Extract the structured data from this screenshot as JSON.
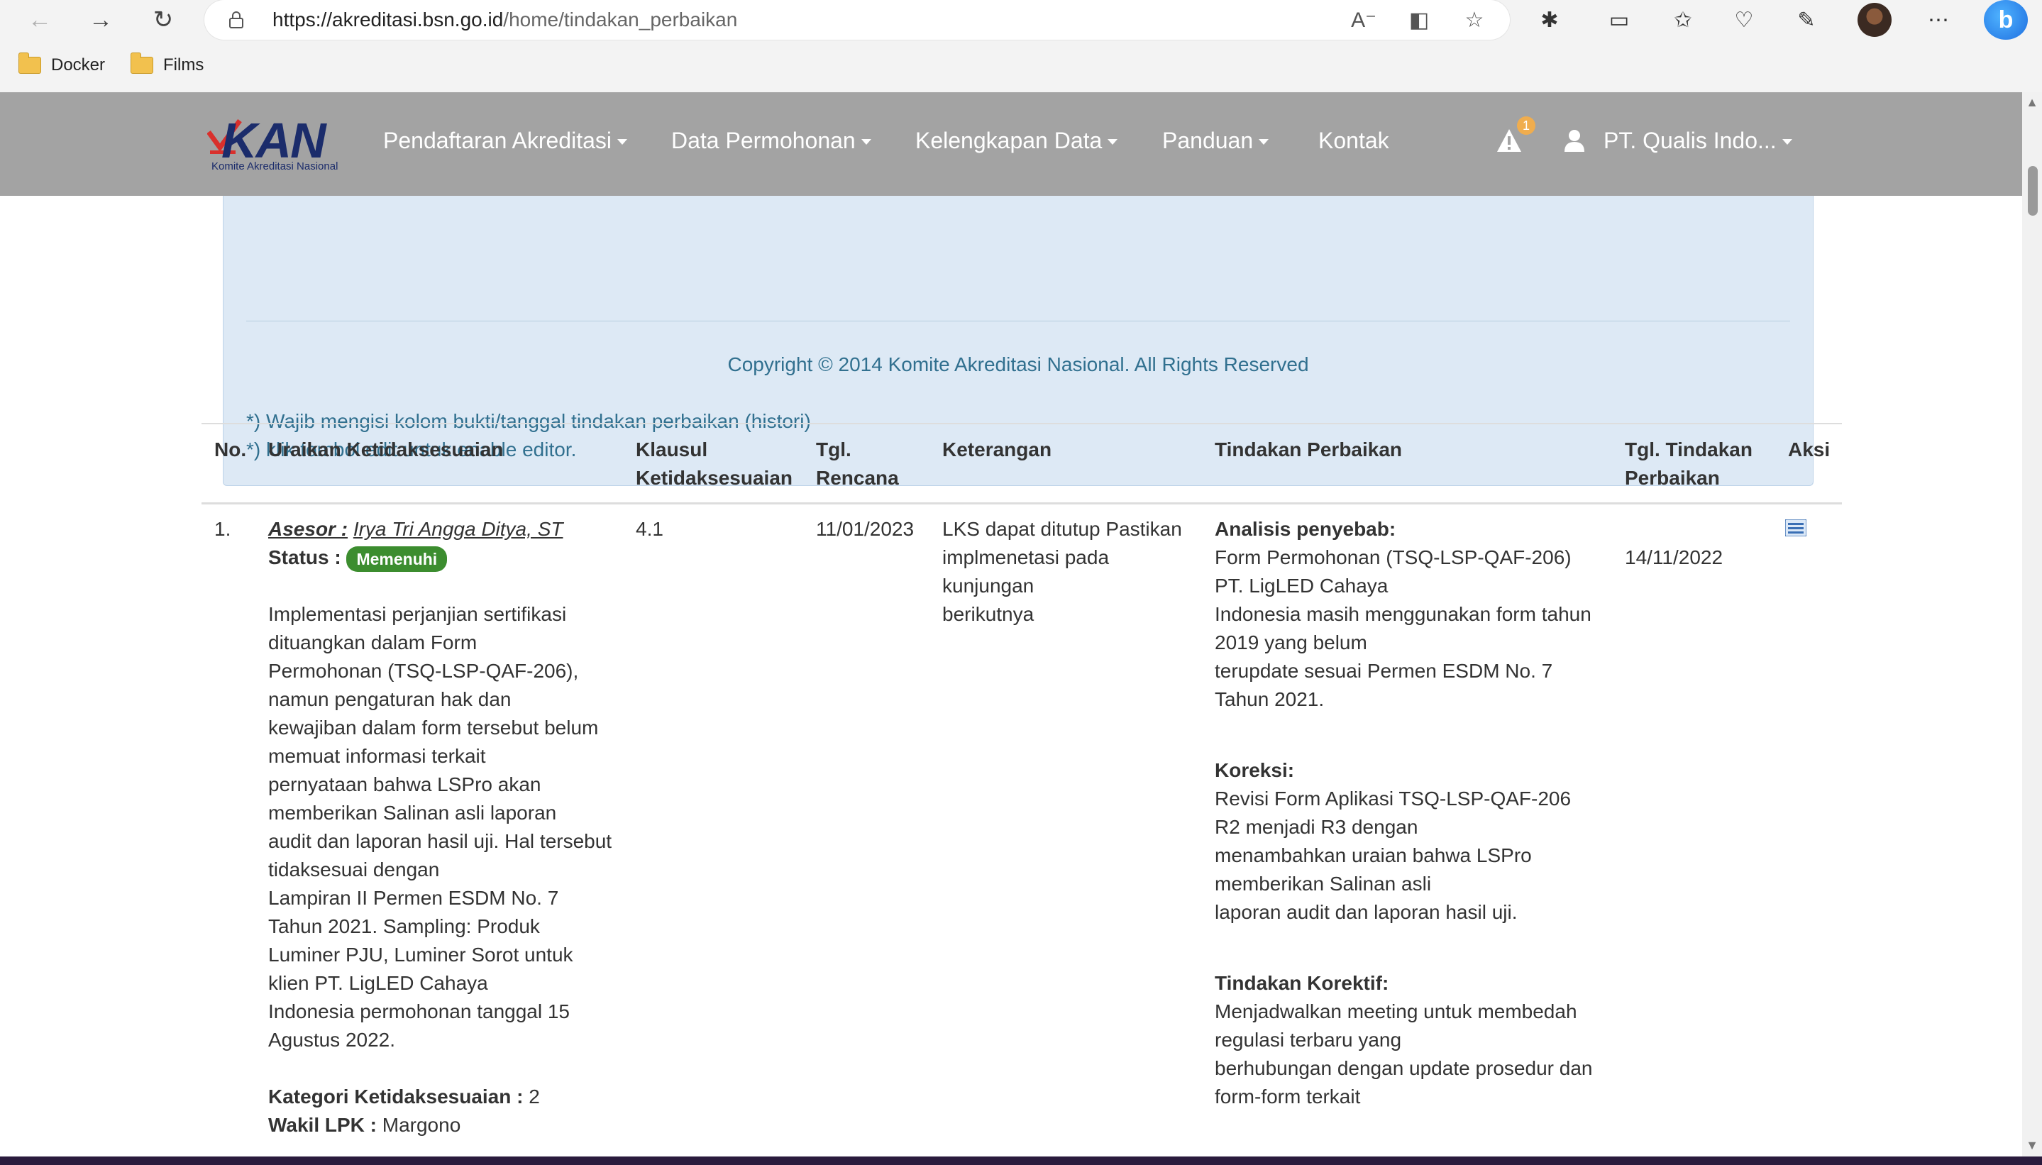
{
  "browser": {
    "url_host": "https://akreditasi.bsn.go.id",
    "url_path": "/home/tindakan_perbaikan",
    "bookmarks": [
      {
        "label": "Docker",
        "icon": "folder-icon"
      },
      {
        "label": "Films",
        "icon": "folder-icon"
      }
    ]
  },
  "site": {
    "logo_text": "KAN",
    "logo_tagline": "Komite Akreditasi Nasional",
    "menu": [
      {
        "label": "Pendaftaran Akreditasi"
      },
      {
        "label": "Data Permohonan"
      },
      {
        "label": "Kelengkapan Data"
      },
      {
        "label": "Panduan"
      },
      {
        "label": "Kontak"
      }
    ],
    "alert_count": "1",
    "user_name": "PT. Qualis Indo..."
  },
  "info_panel": {
    "copyright": "Copyright © 2014 Komite Akreditasi Nasional. All Rights Reserved",
    "note_1": "*) Wajib mengisi kolom bukti/tanggal tindakan perbaikan (histori)",
    "note_2": "*) klik tombol edit untuk enable editor."
  },
  "table": {
    "headers": {
      "no": "No.",
      "uraian": "Uraikan Ketidaksesuaian",
      "klausul_1": "Klausul",
      "klausul_2": "Ketidaksesuaian",
      "rencana_1": "Tgl.",
      "rencana_2": "Rencana",
      "keterangan": "Keterangan",
      "tindakan": "Tindakan Perbaikan",
      "tgl_tindakan_1": "Tgl. Tindakan",
      "tgl_tindakan_2": "Perbaikan",
      "aksi": "Aksi"
    },
    "rows": [
      {
        "no": "1.",
        "asesor_label": "Asesor :",
        "asesor_name": "Irya Tri Angga Ditya, ST",
        "status_label": "Status :",
        "status": "Memenuhi",
        "uraian_lines": [
          "Implementasi perjanjian sertifikasi",
          "dituangkan dalam Form",
          "Permohonan (TSQ-LSP-QAF-206),",
          "namun pengaturan hak dan",
          "kewajiban dalam form tersebut belum",
          "memuat informasi terkait",
          "pernyataan bahwa LSPro akan",
          "memberikan Salinan asli laporan",
          "audit dan laporan hasil uji. Hal tersebut",
          "tidaksesuai dengan",
          "Lampiran II Permen ESDM No. 7",
          "Tahun 2021. Sampling: Produk",
          "Luminer PJU, Luminer Sorot untuk",
          "klien PT. LigLED Cahaya",
          "Indonesia permohonan tanggal 15",
          "Agustus 2022."
        ],
        "kategori_label": "Kategori Ketidaksesuaian :",
        "kategori": "2",
        "wakil_label": "Wakil LPK :",
        "wakil": "Margono",
        "klausul": "4.1",
        "tgl_rencana": "11/01/2023",
        "keterangan_lines": [
          "LKS dapat ditutup Pastikan",
          "implmenetasi pada",
          "kunjungan",
          "berikutnya"
        ],
        "analisis_label": "Analisis penyebab:",
        "analisis_lines": [
          "Form Permohonan (TSQ-LSP-QAF-206)",
          "PT. LigLED Cahaya",
          "Indonesia masih menggunakan form tahun",
          "2019 yang belum",
          "terupdate sesuai Permen ESDM No. 7",
          "Tahun 2021."
        ],
        "koreksi_label": "Koreksi:",
        "koreksi_lines": [
          "Revisi Form Aplikasi TSQ-LSP-QAF-206",
          "R2 menjadi R3 dengan",
          "menambahkan uraian bahwa LSPro",
          "memberikan Salinan asli",
          "laporan audit dan laporan hasil uji."
        ],
        "korektif_label": "Tindakan Korektif:",
        "korektif_lines": [
          "Menjadwalkan meeting untuk membedah",
          "regulasi terbaru yang",
          "berhubungan dengan update prosedur dan",
          "form-form terkait"
        ],
        "tgl_tindakan": "14/11/2022"
      }
    ]
  },
  "colors": {
    "navbar": "#a3a3a3",
    "info_bg": "#dde9f5",
    "info_text": "#31708f",
    "status_green": "#3c8d2f",
    "logo_red": "#d9302c",
    "logo_blue": "#1b2c6b"
  }
}
